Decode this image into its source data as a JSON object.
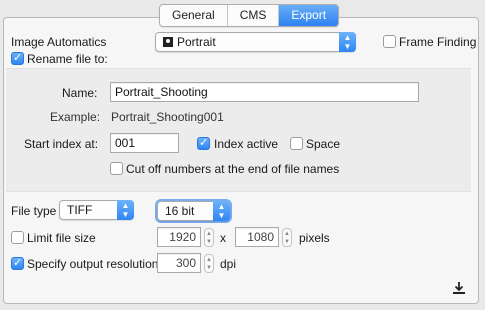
{
  "tabs": [
    "General",
    "CMS",
    "Export"
  ],
  "active_tab": "Export",
  "image_automatics_label": "Image Automatics",
  "preset_select": {
    "icon": "portrait-icon",
    "value": "Portrait"
  },
  "frame_finding": {
    "label": "Frame Finding",
    "checked": false
  },
  "rename": {
    "label": "Rename file to:",
    "checked": true
  },
  "name": {
    "label": "Name:",
    "value": "Portrait_Shooting"
  },
  "example": {
    "label": "Example:",
    "value": "Portrait_Shooting001"
  },
  "start_index": {
    "label": "Start index at:",
    "value": "001"
  },
  "index_active": {
    "label": "Index active",
    "checked": true
  },
  "space": {
    "label": "Space",
    "checked": false
  },
  "cut_off": {
    "label": "Cut off numbers at the end of file names",
    "checked": false
  },
  "file_type": {
    "label": "File type",
    "value": "TIFF"
  },
  "bit_depth": {
    "value": "16 bit"
  },
  "limit_file_size": {
    "label": "Limit file size",
    "checked": false,
    "width": "1920",
    "separator": "x",
    "height": "1080",
    "unit": "pixels"
  },
  "output_resolution": {
    "label": "Specify output resolution",
    "checked": true,
    "value": "300",
    "unit": "dpi"
  },
  "accent_color": "#2f86f2",
  "export_icon": "download-icon"
}
